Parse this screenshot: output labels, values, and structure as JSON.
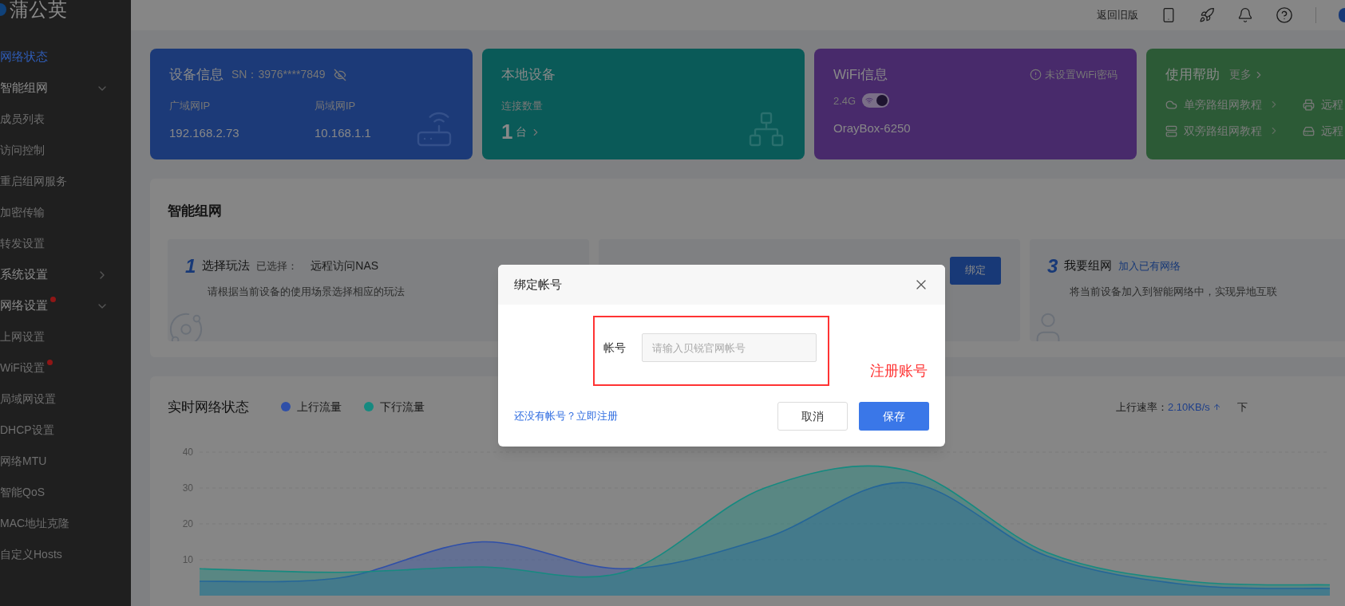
{
  "sidebar": {
    "logo": "蒲公英",
    "items": [
      {
        "kind": "link",
        "label": "网络状态",
        "selected": true
      },
      {
        "kind": "group",
        "label": "智能组网",
        "selected": false,
        "expanded": true,
        "badge": false,
        "children": [
          {
            "label": "成员列表",
            "selected": false,
            "badge": false
          },
          {
            "label": "访问控制",
            "selected": false,
            "badge": false
          },
          {
            "label": "重启组网服务",
            "selected": false,
            "badge": false
          },
          {
            "label": "加密传输",
            "selected": false,
            "badge": false
          },
          {
            "label": "转发设置",
            "selected": false,
            "badge": false
          }
        ]
      },
      {
        "kind": "group",
        "label": "系统设置",
        "selected": false,
        "expanded": false,
        "badge": false
      },
      {
        "kind": "group",
        "label": "网络设置",
        "selected": false,
        "expanded": true,
        "badge": true,
        "children": [
          {
            "label": "上网设置",
            "selected": false,
            "badge": false
          },
          {
            "label": "WiFi设置",
            "selected": false,
            "badge": true
          },
          {
            "label": "局域网设置",
            "selected": false,
            "badge": false
          },
          {
            "label": "DHCP设置",
            "selected": false,
            "badge": false
          },
          {
            "label": "网络MTU",
            "selected": false,
            "badge": false
          },
          {
            "label": "智能QoS",
            "selected": false,
            "badge": false
          },
          {
            "label": "MAC地址克隆",
            "selected": false,
            "badge": false
          },
          {
            "label": "自定义Hosts",
            "selected": false,
            "badge": false
          }
        ]
      }
    ]
  },
  "header": {
    "back_link": "返回旧版"
  },
  "cards": {
    "device": {
      "title": "设备信息",
      "sn": "SN：3976****7849",
      "wan_label": "广域网IP",
      "wan": "192.168.2.73",
      "lan_label": "局域网IP",
      "lan": "10.168.1.1"
    },
    "local": {
      "title": "本地设备",
      "label": "连接数量",
      "count": "1",
      "unit": "台"
    },
    "wifi": {
      "title": "WiFi信息",
      "warning": "未设置WiFi密码",
      "band": "2.4G",
      "on": true,
      "ssid": "OrayBox-6250"
    },
    "help": {
      "title": "使用帮助",
      "more": "更多",
      "links": [
        {
          "kind": "cloud",
          "label": "单旁路组网教程"
        },
        {
          "kind": "printer",
          "label": "远程"
        },
        {
          "kind": "server",
          "label": "双旁路组网教程"
        },
        {
          "kind": "drive",
          "label": "远程"
        }
      ]
    }
  },
  "smart_network": {
    "title": "智能组网",
    "steps": [
      {
        "number": "1",
        "title": "选择玩法",
        "note": "已选择：",
        "value": "远程访问NAS",
        "description": "请根据当前设备的使用场景选择相应的玩法"
      },
      {
        "button": "绑定"
      },
      {
        "number": "3",
        "title": "我要组网",
        "link": "加入已有网络",
        "description": "将当前设备加入到智能网络中，实现异地互联"
      }
    ]
  },
  "realtime": {
    "title": "实时网络状态",
    "rate_label": "上行速率：",
    "rate": "2.10KB/s",
    "next_label": "下",
    "chart_data": {
      "type": "area",
      "ylim": [
        0,
        40
      ],
      "yticks": [
        10,
        20,
        30,
        40
      ],
      "grid": true,
      "series": [
        {
          "name": "上行流量",
          "color": "#2f4fa8",
          "values": [
            4,
            5,
            15,
            7.5,
            16,
            31.5,
            11,
            3,
            2
          ]
        },
        {
          "name": "下行流量",
          "color": "#168a80",
          "values": [
            7.5,
            6.5,
            8,
            6.5,
            30,
            35,
            12,
            4,
            3
          ]
        }
      ]
    }
  },
  "dialog": {
    "title": "绑定帐号",
    "field_label": "帐号",
    "placeholder": "请输入贝锐官网帐号",
    "register_link": "还没有帐号？立即注册",
    "cancel": "取消",
    "save": "保存"
  },
  "annotation": {
    "label": "注册账号"
  }
}
